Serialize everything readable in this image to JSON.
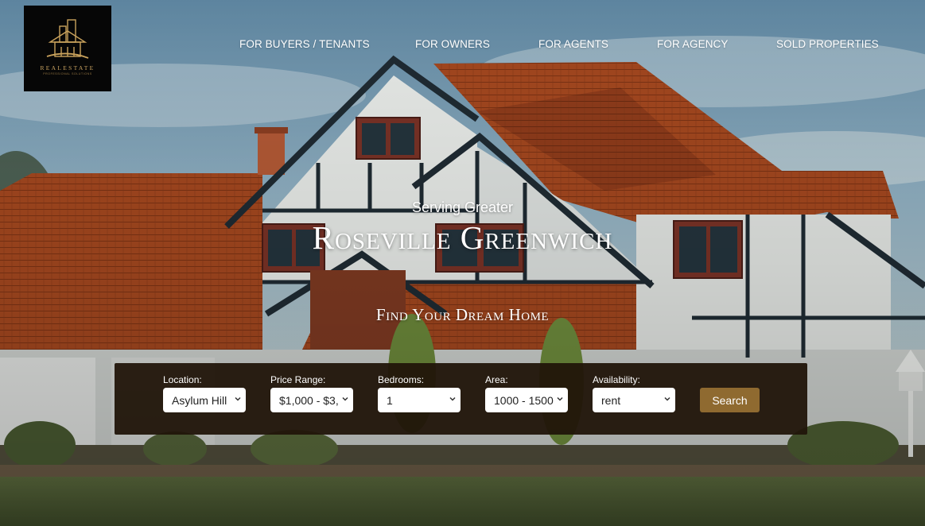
{
  "brand": {
    "logo_text": "REALESTATE",
    "logo_tagline": "PROFESSIONAL SOLUTIONS"
  },
  "nav": {
    "items": [
      "FOR BUYERS / TENANTS",
      "FOR OWNERS",
      "FOR AGENTS",
      "FOR AGENCY",
      "SOLD PROPERTIES"
    ]
  },
  "hero": {
    "eyebrow": "Serving Greater",
    "headline": "Roseville Greenwich",
    "subheadline": "Find Your Dream Home"
  },
  "search": {
    "fields": [
      {
        "label": "Location:",
        "value": "Asylum Hill"
      },
      {
        "label": "Price Range:",
        "value": "$1,000 - $3,"
      },
      {
        "label": "Bedrooms:",
        "value": "1"
      },
      {
        "label": "Area:",
        "value": "1000 - 1500"
      },
      {
        "label": "Availability:",
        "value": "rent"
      }
    ],
    "button_label": "Search"
  },
  "colors": {
    "panel": "#211509",
    "button": "#8f6a30",
    "roof": "#a84a26",
    "timber": "#1d2c35"
  }
}
